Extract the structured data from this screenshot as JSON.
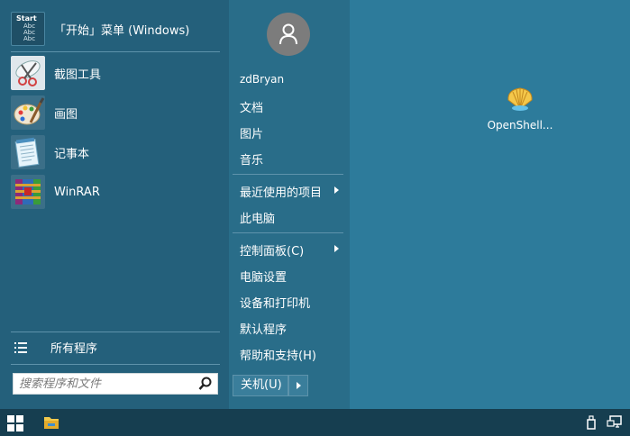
{
  "start_menu": {
    "programs": [
      {
        "label": "「开始」菜单 (Windows)",
        "icon": "start-menu-icon",
        "icon_text": [
          "Start",
          "Abc",
          "Abc",
          "Abc"
        ]
      },
      {
        "label": "截图工具",
        "icon": "snipping-tool-icon"
      },
      {
        "label": "画图",
        "icon": "paint-icon"
      },
      {
        "label": "记事本",
        "icon": "notepad-icon"
      },
      {
        "label": "WinRAR",
        "icon": "winrar-icon"
      }
    ],
    "all_programs": "所有程序",
    "search_placeholder": "搜索程序和文件",
    "user_name": "zdBryan",
    "places": [
      "文档",
      "图片",
      "音乐"
    ],
    "recent_items": "最近使用的项目",
    "this_pc": "此电脑",
    "control_panel": "控制面板(C)",
    "settings_items": [
      "电脑设置",
      "设备和打印机",
      "默认程序",
      "帮助和支持(H)"
    ],
    "shutdown": "关机(U)"
  },
  "desktop": {
    "icons": [
      {
        "label": "OpenShell...",
        "icon": "openshell-icon"
      }
    ]
  },
  "taskbar": {
    "icons": [
      "windows-logo-icon",
      "file-explorer-icon",
      "usb-eject-icon",
      "network-icon"
    ]
  },
  "colors": {
    "desktop": "#2d7b9b",
    "start_left": "#24607b",
    "start_right": "#296d89",
    "taskbar": "#163e50"
  }
}
